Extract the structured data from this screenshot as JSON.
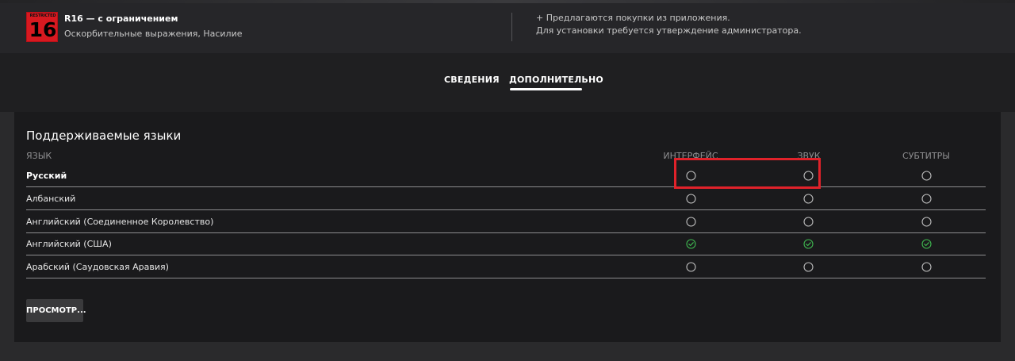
{
  "rating": {
    "badge_caption": "RESTRICTED",
    "badge_number": "16",
    "title": "R16 — с ограничением",
    "description": "Оскорбительные выражения, Насилие"
  },
  "notices": {
    "line1": "+ Предлагаются покупки из приложения.",
    "line2": "Для установки требуется утверждение администратора."
  },
  "tabs": [
    {
      "label": "СВЕДЕНИЯ",
      "active": false
    },
    {
      "label": "ДОПОЛНИТЕЛЬНО",
      "active": true
    }
  ],
  "languages": {
    "title": "Поддерживаемые языки",
    "columns": {
      "language": "ЯЗЫК",
      "interface": "ИНТЕРФЕЙС",
      "audio": "ЗВУК",
      "subtitles": "СУБТИТРЫ"
    },
    "rows": [
      {
        "name": "Русский",
        "interface": false,
        "audio": false,
        "subtitles": false
      },
      {
        "name": "Албанский",
        "interface": false,
        "audio": false,
        "subtitles": false
      },
      {
        "name": "Английский (Соединенное Королевство)",
        "interface": false,
        "audio": false,
        "subtitles": false
      },
      {
        "name": "Английский (США)",
        "interface": true,
        "audio": true,
        "subtitles": true
      },
      {
        "name": "Арабский (Саудовская Аравия)",
        "interface": false,
        "audio": false,
        "subtitles": false
      }
    ]
  },
  "review_button": "ПРОСМОТР...",
  "colors": {
    "supported": "#3fb950",
    "unsupported": "#bdbdbd",
    "highlight": "#e0222a",
    "rating_red": "#d71920"
  },
  "icons": {
    "supported": "check-circle-icon",
    "unsupported": "empty-circle-icon"
  }
}
